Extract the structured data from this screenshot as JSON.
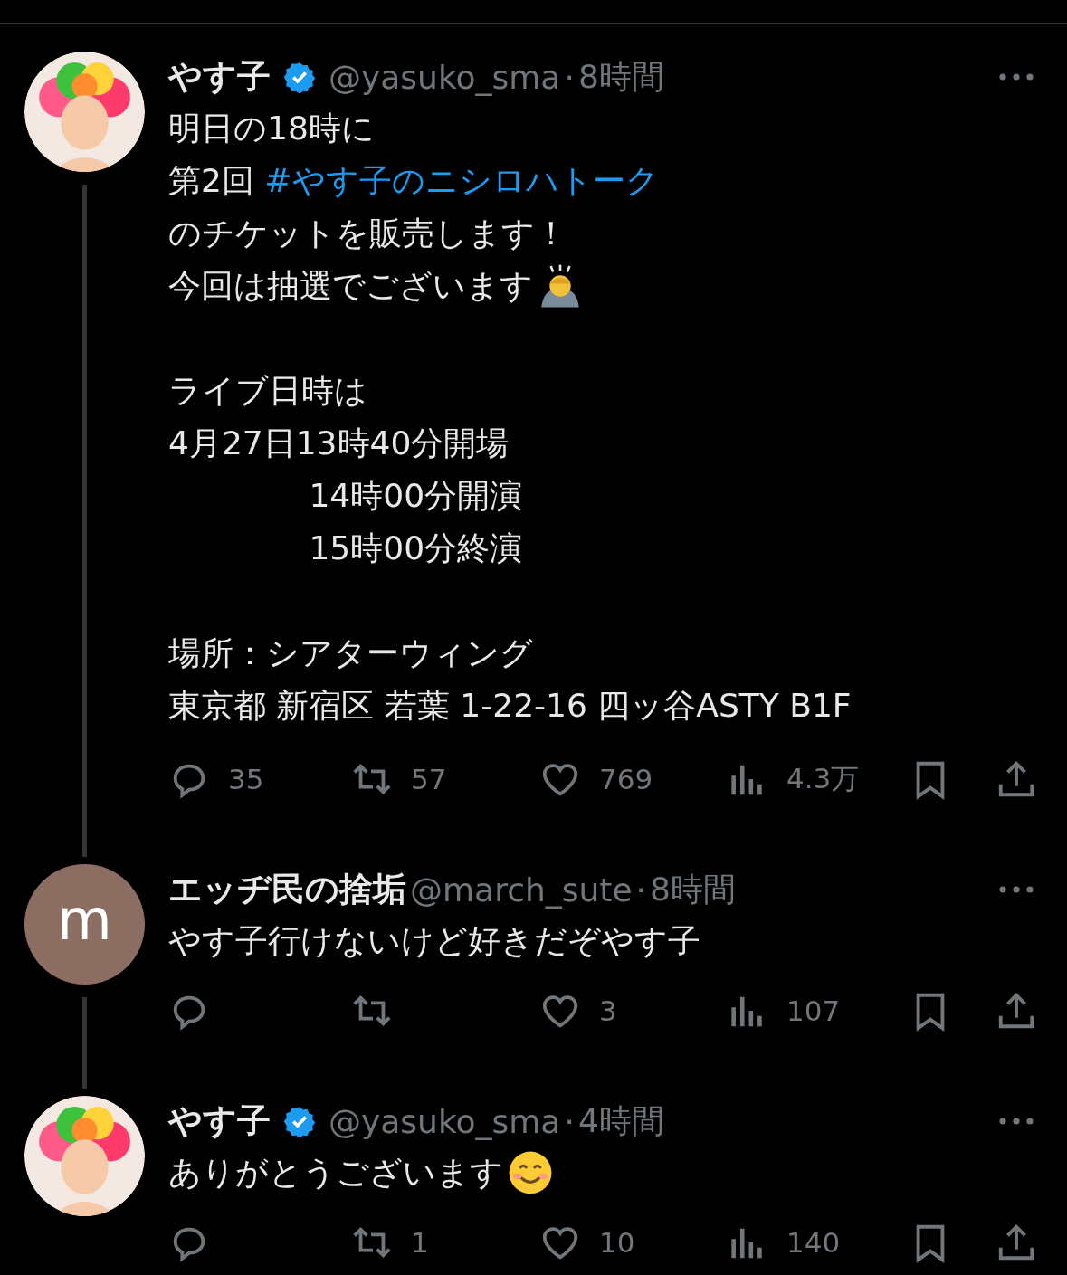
{
  "tweets": [
    {
      "avatar": {
        "kind": "photo"
      },
      "name": "やす子",
      "verified": true,
      "handle": "@yasuko_sma",
      "separator": "·",
      "time": "8時間",
      "connected": true,
      "paragraphs": [
        [
          [
            {
              "kind": "text",
              "text": "明日の18時に"
            }
          ],
          [
            {
              "kind": "text",
              "text": "第2回 "
            },
            {
              "kind": "hashtag",
              "text": "#やす子のニシロハトーク"
            }
          ],
          [
            {
              "kind": "text",
              "text": "のチケットを販売します！"
            }
          ],
          [
            {
              "kind": "text",
              "text": "今回は抽選でございます"
            },
            {
              "kind": "bowing"
            }
          ]
        ],
        [
          [
            {
              "kind": "text",
              "text": "ライブ日時は"
            }
          ],
          [
            {
              "kind": "text",
              "text": "4月27日13時40分開場"
            }
          ],
          [
            {
              "kind": "text",
              "text": "　　　　 14時00分開演"
            }
          ],
          [
            {
              "kind": "text",
              "text": "　　　　 15時00分終演"
            }
          ]
        ],
        [
          [
            {
              "kind": "text",
              "text": "場所：シアターウィング"
            }
          ],
          [
            {
              "kind": "text",
              "text": "東京都 新宿区 若葉 1-22-16 四ッ谷ASTY B1F"
            }
          ]
        ]
      ],
      "actions": {
        "replies": "35",
        "reposts": "57",
        "likes": "769",
        "views": "4.3万"
      }
    },
    {
      "avatar": {
        "kind": "letter",
        "letter": "m"
      },
      "name": "エッヂ民の捨垢",
      "verified": false,
      "handle": "@march_sute",
      "separator": "·",
      "time": "8時間",
      "connected": true,
      "paragraphs": [
        [
          [
            {
              "kind": "text",
              "text": "やす子行けないけど好きだぞやす子"
            }
          ]
        ]
      ],
      "actions": {
        "likes": "3",
        "views": "107"
      }
    },
    {
      "avatar": {
        "kind": "photo"
      },
      "name": "やす子",
      "verified": true,
      "handle": "@yasuko_sma",
      "separator": "·",
      "time": "4時間",
      "connected": false,
      "paragraphs": [
        [
          [
            {
              "kind": "text",
              "text": "ありがとうございます"
            },
            {
              "kind": "smile"
            }
          ]
        ]
      ],
      "actions": {
        "reposts": "1",
        "likes": "10",
        "views": "140"
      }
    }
  ]
}
